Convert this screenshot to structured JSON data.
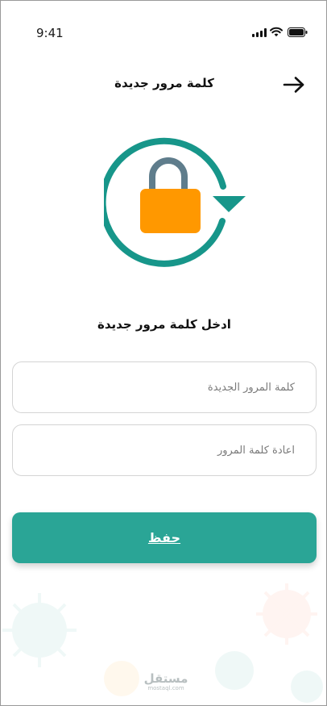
{
  "status_bar": {
    "time": "9:41"
  },
  "header": {
    "title": "كلمة مرور جديدة",
    "back_icon": "arrow-right-icon"
  },
  "illustration": {
    "icon": "lock-refresh-icon",
    "colors": {
      "ring": "#17968a",
      "lock_body": "#ff9800",
      "shackle": "#5f7d8c"
    }
  },
  "instruction": "ادخل كلمة مرور جديدة",
  "fields": {
    "new_password": {
      "placeholder": "كلمة المرور الجديدة",
      "value": ""
    },
    "confirm_password": {
      "placeholder": "اعادة كلمة المرور",
      "value": ""
    }
  },
  "save_button": {
    "label": "حفظ",
    "color": "#2aa596"
  },
  "watermark": {
    "main": "مستقل",
    "sub": "mostaql.com"
  }
}
